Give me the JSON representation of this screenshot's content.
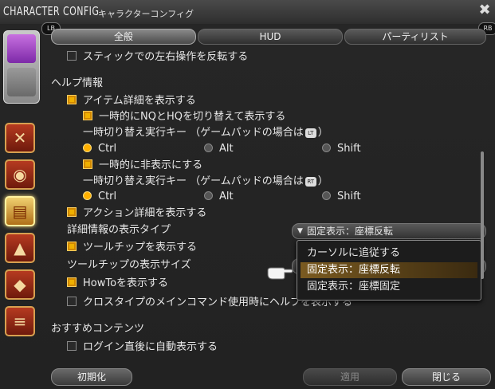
{
  "window": {
    "title": "CHARACTER CONFIG",
    "subtitle": "キャラクターコンフィグ",
    "close_icon": "close-icon"
  },
  "tabs": [
    {
      "label": "全般",
      "active": true
    },
    {
      "label": "HUD",
      "active": false
    },
    {
      "label": "パーティリスト",
      "active": false
    }
  ],
  "bumpers": {
    "left": "LB",
    "right": "RB"
  },
  "rows": {
    "stick_invert": "スティックでの左右操作を反転する",
    "help_heading": "ヘルプ情報",
    "item_detail": "アイテム詳細を表示する",
    "nq_hq": "一時的にNQとHQを切り替えて表示する",
    "key1_label": "一時切り替え実行キー （ゲームパッドの場合は",
    "key1_icon": "LT",
    "key_close": "）",
    "ctrl": "Ctrl",
    "alt": "Alt",
    "shift": "Shift",
    "hide_temp": "一時的に非表示にする",
    "key2_label": "一時切り替え実行キー （ゲームパッドの場合は",
    "key2_icon": "RT",
    "action_detail": "アクション詳細を表示する",
    "detail_type": "詳細情報の表示タイプ",
    "tooltip_show": "ツールチップを表示する",
    "tooltip_size": "ツールチップの表示サイズ",
    "howto": "HowToを表示する",
    "crosstype": "クロスタイプのメインコマンド使用時にヘルプを表示する",
    "recommend_heading": "おすすめコンテンツ",
    "login_show": "ログイン直後に自動表示する"
  },
  "dropdown": {
    "selected": "固定表示：座標反転",
    "options": [
      "カーソルに追従する",
      "固定表示：座標反転",
      "固定表示：座標固定"
    ]
  },
  "footer": {
    "reset": "初期化",
    "apply": "適用",
    "close": "閉じる"
  }
}
